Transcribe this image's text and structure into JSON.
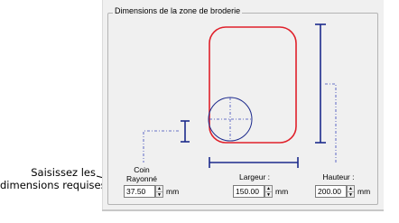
{
  "callout": {
    "line1": "Saisissez les",
    "line2": "dimensions requises"
  },
  "group": {
    "title": "Dimensions de la zone de broderie"
  },
  "corner": {
    "label_line1": "Coin",
    "label_line2": "Rayonné",
    "value": "37.50",
    "unit": "mm"
  },
  "width": {
    "label": "Largeur :",
    "value": "150.00",
    "unit": "mm"
  },
  "height": {
    "label": "Hauteur :",
    "value": "200.00",
    "unit": "mm"
  },
  "colors": {
    "hoop_outline": "#e0202a",
    "dimension_marker": "#1c2a8c",
    "guide_dashes": "#3a48b8"
  }
}
